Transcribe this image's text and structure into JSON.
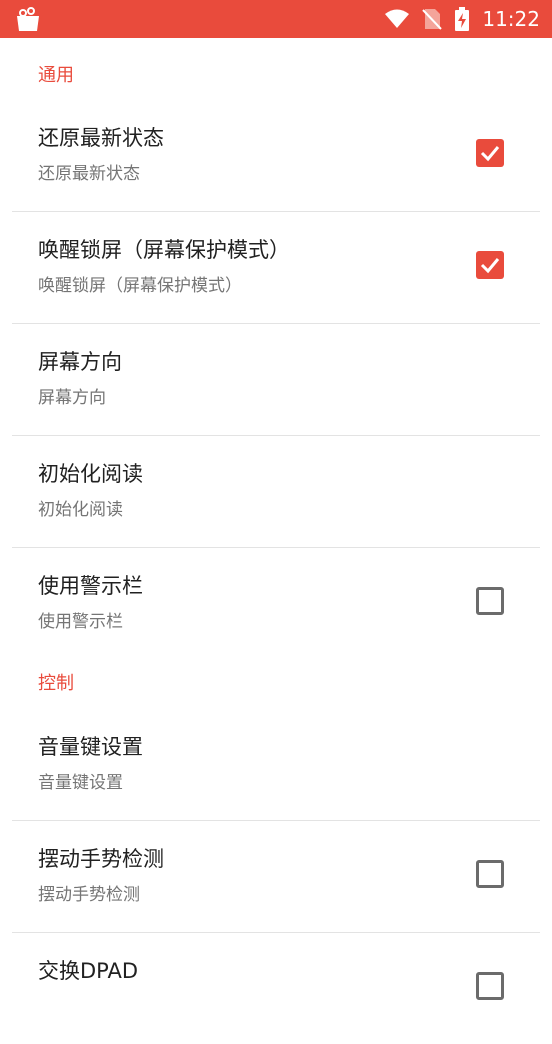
{
  "status_bar": {
    "time": "11:22",
    "app_icon": "shopping-bag-icon",
    "wifi_icon": "wifi-icon",
    "sim_icon": "no-sim-icon",
    "battery_icon": "battery-charging-icon",
    "color": "#e94b3c"
  },
  "sections": {
    "general": {
      "title": "通用",
      "items": [
        {
          "title": "还原最新状态",
          "summary": "还原最新状态",
          "checked": true
        },
        {
          "title": "唤醒锁屏（屏幕保护模式）",
          "summary": "唤醒锁屏（屏幕保护模式）",
          "checked": true
        },
        {
          "title": "屏幕方向",
          "summary": "屏幕方向"
        },
        {
          "title": "初始化阅读",
          "summary": "初始化阅读"
        },
        {
          "title": "使用警示栏",
          "summary": "使用警示栏",
          "checked": false
        }
      ]
    },
    "control": {
      "title": "控制",
      "items": [
        {
          "title": "音量键设置",
          "summary": "音量键设置"
        },
        {
          "title": "摆动手势检测",
          "summary": "摆动手势检测",
          "checked": false
        },
        {
          "title": "交换DPAD",
          "summary": "",
          "checked": false
        }
      ]
    }
  }
}
